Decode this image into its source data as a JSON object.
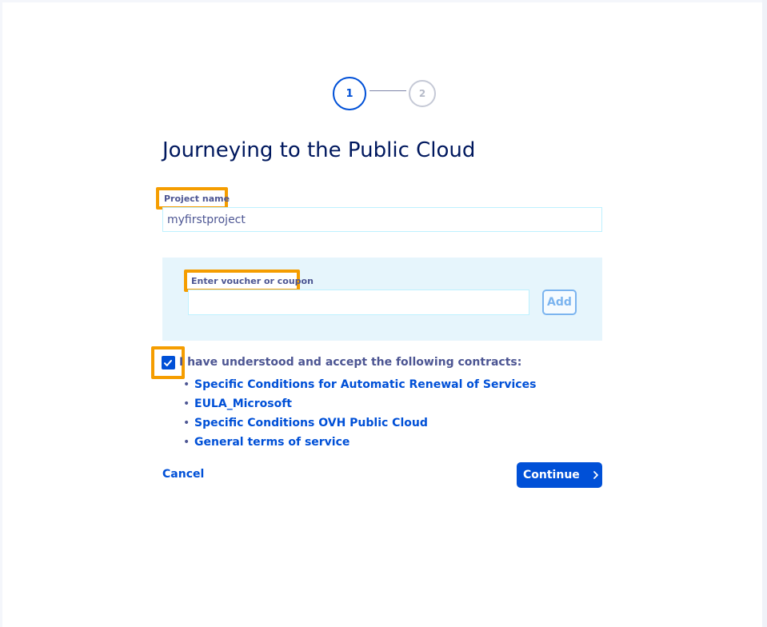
{
  "stepper": {
    "steps": [
      {
        "number": "1",
        "state": "active"
      },
      {
        "number": "2",
        "state": "inactive"
      }
    ]
  },
  "page_title": "Journeying to the Public Cloud",
  "project": {
    "label": "Project name",
    "value": "myfirstproject"
  },
  "voucher": {
    "label": "Enter voucher or coupon",
    "value": "",
    "add_label": "Add"
  },
  "contracts": {
    "accept_text": "I have understood and accept the following contracts:",
    "checked": true,
    "items": [
      "Specific Conditions for Automatic Renewal of Services",
      "EULA_Microsoft",
      "Specific Conditions OVH Public Cloud",
      "General terms of service"
    ]
  },
  "actions": {
    "cancel_label": "Cancel",
    "continue_label": "Continue"
  },
  "colors": {
    "primary": "#0050d7",
    "highlight": "#f59d00",
    "title": "#00185e",
    "panel": "#e6f5fc"
  },
  "icons": {
    "checkbox": "checkmark-icon",
    "continue": "chevron-right-icon"
  }
}
